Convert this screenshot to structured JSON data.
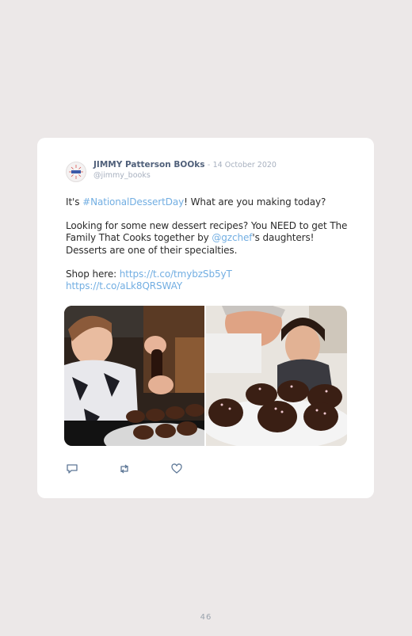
{
  "tweet": {
    "author_name": "JIMMY Patterson BOOks",
    "separator": "-",
    "date": "14 October 2020",
    "handle": "@jimmy_books",
    "line1_pre": "It's ",
    "line1_hashtag": "#NationalDessertDay",
    "line1_post": "! What are you making today?",
    "para2_pre": "Looking for some new dessert recipes? You NEED to get The Family That Cooks together by ",
    "para2_mention": "@gzchef",
    "para2_post": "'s daughters! Desserts are one of their specialties.",
    "shop_label": "Shop here: ",
    "link1": "https://t.co/tmybzSb5yT",
    "link2": "https://t.co/aLk8QRSWAY"
  },
  "icons": {
    "reply": "reply-icon",
    "retweet": "retweet-icon",
    "like": "heart-icon"
  },
  "page_number": "46"
}
